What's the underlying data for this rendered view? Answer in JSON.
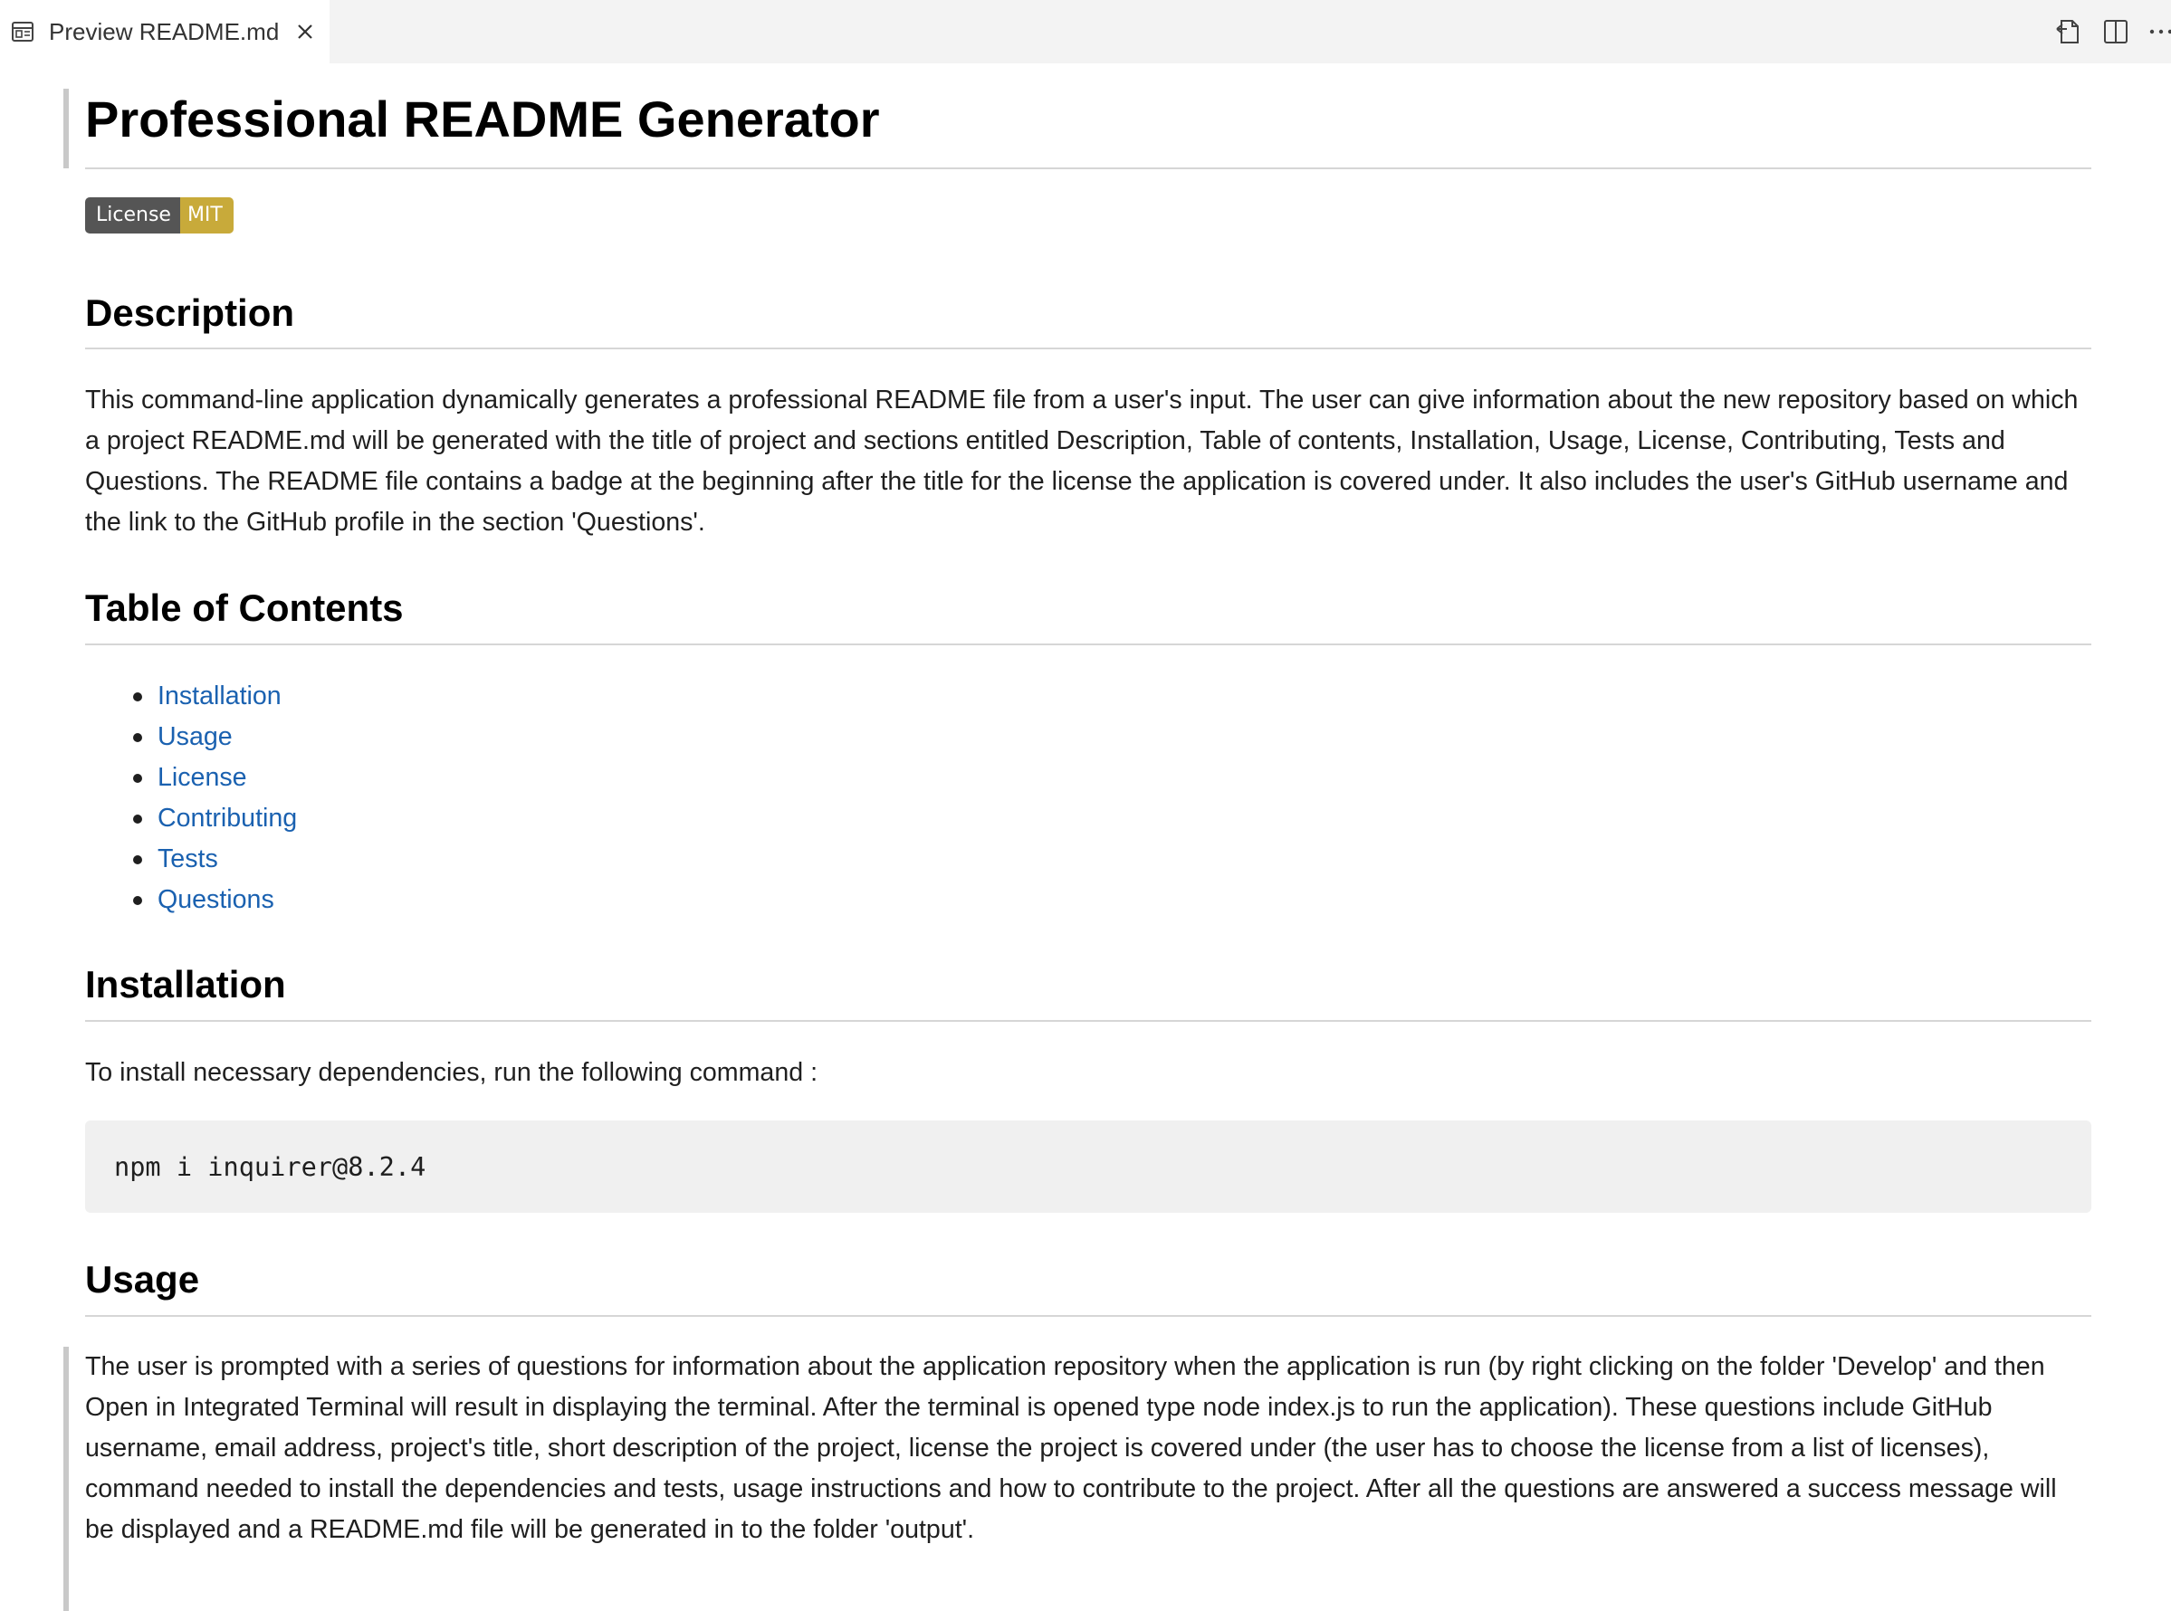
{
  "tab": {
    "title": "Preview README.md",
    "icon": "preview-icon",
    "close_icon": "close-icon"
  },
  "editor_actions": [
    {
      "name": "open-source-icon"
    },
    {
      "name": "split-editor-icon"
    },
    {
      "name": "more-actions-icon"
    }
  ],
  "colors": {
    "link": "#1a61b0",
    "badge_label_bg": "#555555",
    "badge_value_bg": "#c8aa3a",
    "code_bg": "#f0f0f0"
  },
  "document": {
    "title": "Professional README Generator",
    "badge": {
      "label": "License",
      "value": "MIT"
    },
    "description": {
      "heading": "Description",
      "text": "This command-line application dynamically generates a professional README file from a user's input. The user can give information about the new repository based on which a project README.md will be generated with the title of project and sections entitled Description, Table of contents, Installation, Usage, License, Contributing, Tests and Questions. The README file contains a badge at the beginning after the title for the license the application is covered under. It also includes the user's GitHub username and the link to the GitHub profile in the section 'Questions'."
    },
    "toc": {
      "heading": "Table of Contents",
      "items": [
        "Installation",
        "Usage",
        "License",
        "Contributing",
        "Tests",
        "Questions"
      ]
    },
    "installation": {
      "heading": "Installation",
      "text": "To install necessary dependencies, run the following command :",
      "command": "npm i inquirer@8.2.4"
    },
    "usage": {
      "heading": "Usage",
      "text": "The user is prompted with a series of questions for information about the application repository when the application is run (by right clicking on the folder 'Develop' and then Open in Integrated Terminal will result in displaying the terminal. After the terminal is opened type node index.js to run the application). These questions include GitHub username, email address, project's title, short description of the project, license the project is covered under (the user has to choose the license from a list of licenses), command needed to install the dependencies and tests, usage instructions and how to contribute to the project. After all the questions are answered a success message will be displayed and a README.md file will be generated in to the folder 'output'."
    }
  }
}
